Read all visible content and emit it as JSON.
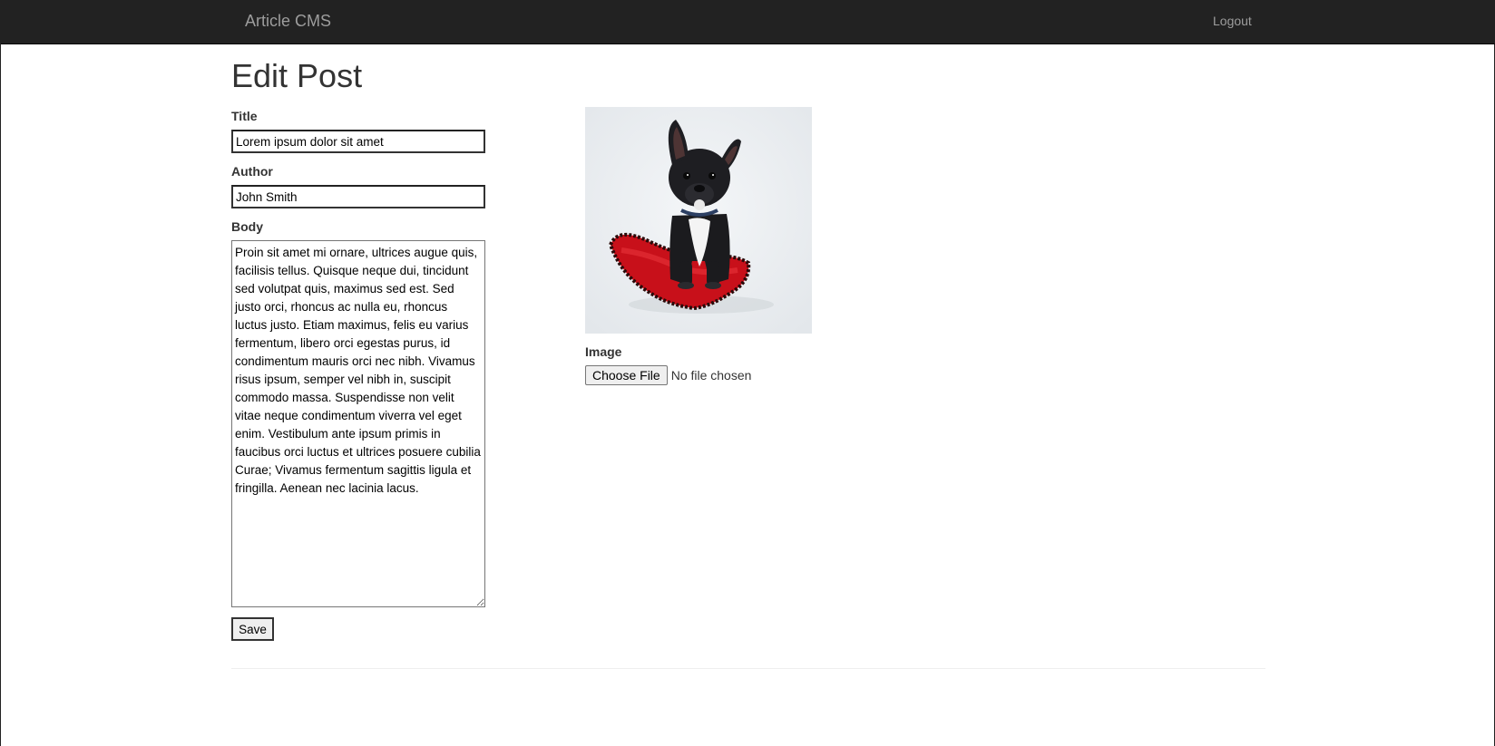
{
  "navbar": {
    "brand": "Article CMS",
    "logout": "Logout"
  },
  "page": {
    "title": "Edit Post"
  },
  "form": {
    "title_label": "Title",
    "title_value": "Lorem ipsum dolor sit amet",
    "author_label": "Author",
    "author_value": "John Smith",
    "body_label": "Body",
    "body_value": "Proin sit amet mi ornare, ultrices augue quis, facilisis tellus. Quisque neque dui, tincidunt sed volutpat quis, maximus sed est. Sed justo orci, rhoncus ac nulla eu, rhoncus luctus justo. Etiam maximus, felis eu varius fermentum, libero orci egestas purus, id condimentum mauris orci nec nibh. Vivamus risus ipsum, semper vel nibh in, suscipit commodo massa. Suspendisse non velit vitae neque condimentum viverra vel eget enim. Vestibulum ante ipsum primis in faucibus orci luctus et ultrices posuere cubilia Curae; Vivamus fermentum sagittis ligula et fringilla. Aenean nec lacinia lacus.",
    "save_label": "Save"
  },
  "image_panel": {
    "image_label": "Image",
    "choose_file_label": "Choose File",
    "file_status": "No file chosen"
  },
  "colors": {
    "navbar_bg": "#222222",
    "navbar_text": "#9d9d9d",
    "pillow_red": "#d0121b"
  }
}
